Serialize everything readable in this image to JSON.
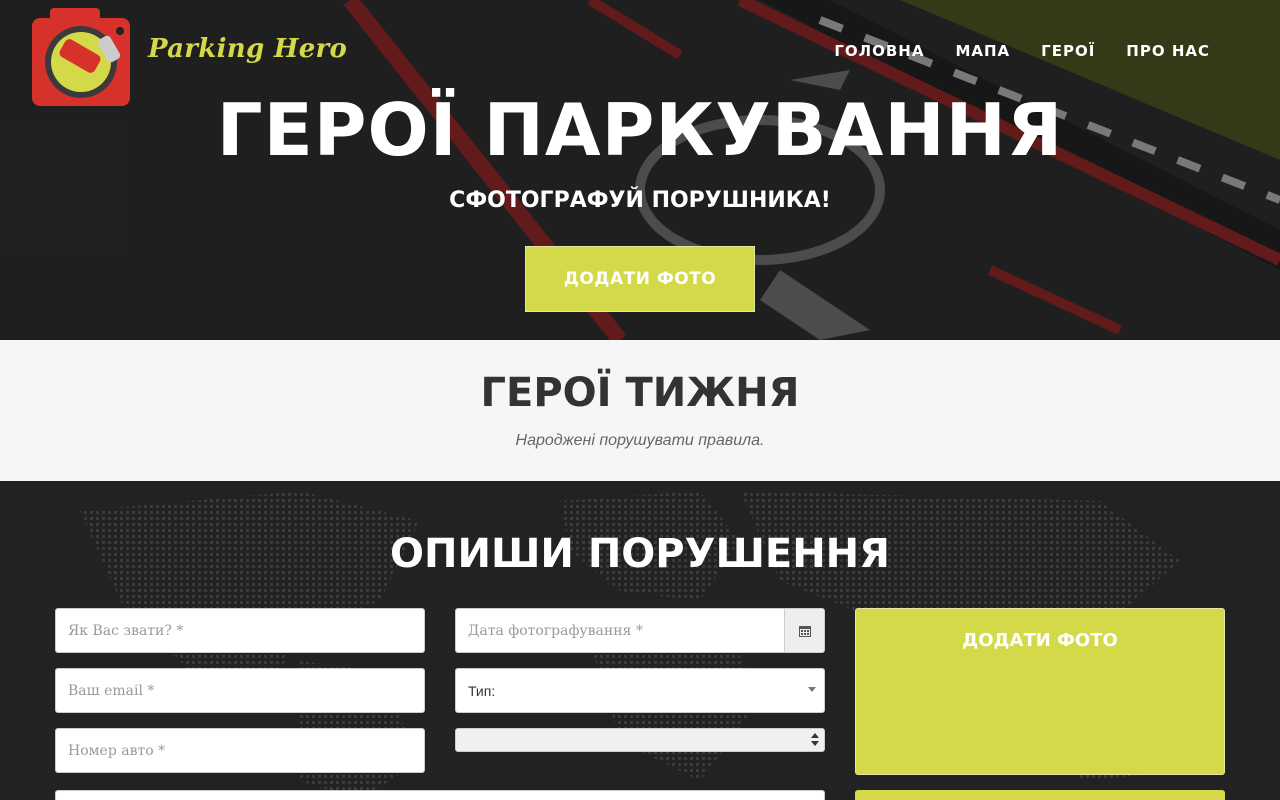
{
  "brand": {
    "name": "Parking Hero",
    "logo_icon": "camera-car-logo-icon"
  },
  "nav": {
    "items": [
      {
        "label": "ГОЛОВНА"
      },
      {
        "label": "МАПА"
      },
      {
        "label": "ГЕРОЇ"
      },
      {
        "label": "ПРО НАС"
      }
    ]
  },
  "hero": {
    "title": "ГЕРОЇ ПАРКУВАННЯ",
    "subtitle": "СФОТОГРАФУЙ ПОРУШНИКА!",
    "button": "ДОДАТИ ФОТО"
  },
  "week": {
    "title": "ГЕРОЇ ТИЖНЯ",
    "subtitle": "Народжені порушувати правила."
  },
  "report": {
    "title": "ОПИШИ ПОРУШЕННЯ",
    "name_placeholder": "Як Вас звати? *",
    "email_placeholder": "Ваш email *",
    "plate_placeholder": "Номер авто *",
    "date_placeholder": "Дата фотографування *",
    "type_label": "Тип:",
    "photo_button": "ДОДАТИ ФОТО"
  },
  "colors": {
    "accent": "#d4d94a",
    "dark": "#222222",
    "light": "#f6f6f6"
  }
}
